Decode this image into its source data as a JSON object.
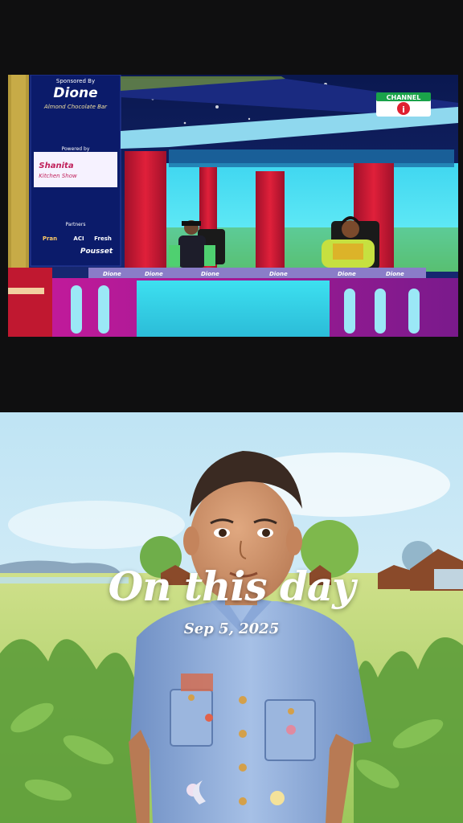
{
  "top_video": {
    "sponsor_label": "Sponsored By",
    "brand": "Dione",
    "brand_sub": "Almond Chocolate Bar",
    "powered_label": "Powered by",
    "powered_brand": "Shanita",
    "powered_sub": "Kitchen Show",
    "partners_label": "Partners",
    "partner_names": [
      "Pran",
      "ACI",
      "Fresh",
      "Pousset"
    ],
    "channel_logo_text": "CHANNEL",
    "channel_logo_number": "i",
    "desk_brand": "Dione"
  },
  "overlay": {
    "title": "On this day",
    "date": "Sep 5, 2025"
  }
}
